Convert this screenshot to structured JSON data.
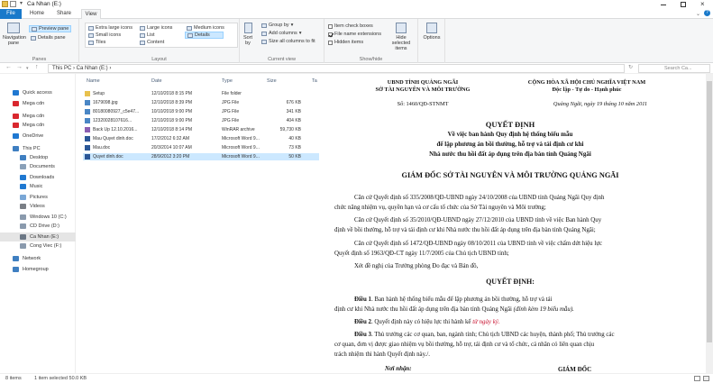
{
  "window": {
    "title": "Ca Nhan (E:)"
  },
  "tabs": [
    "File",
    "Home",
    "Share",
    "View"
  ],
  "ribbon": {
    "panes": {
      "navigation": "Navigation pane",
      "preview": "Preview pane",
      "details": "Details pane",
      "label": "Panes"
    },
    "layout": {
      "items": [
        "Extra large icons",
        "Large icons",
        "Medium icons",
        "Small icons",
        "List",
        "Details",
        "Tiles",
        "Content"
      ],
      "label": "Layout"
    },
    "current_view": {
      "sort": "Sort by",
      "group": "Group by",
      "add_columns": "Add columns",
      "size_all": "Size all columns to fit",
      "label": "Current view"
    },
    "show_hide": {
      "item_check": "Item check boxes",
      "extensions": "File name extensions",
      "hidden": "Hidden items",
      "hide_selected": "Hide selected items",
      "label": "Show/hide"
    },
    "options": "Options"
  },
  "address": {
    "path": "This PC  ›  Ca Nhan (E:)  ›",
    "search_placeholder": "Search Ca..."
  },
  "nav": [
    {
      "label": "Quick access",
      "color": "#1f78d1"
    },
    {
      "label": "Mega cdn",
      "color": "#d9272e"
    },
    {
      "label": "Mega cdn",
      "color": "#d9272e"
    },
    {
      "label": "Mega cdn",
      "color": "#d9272e"
    },
    {
      "label": "OneDrive",
      "color": "#1f78d1"
    },
    {
      "label": "This PC",
      "color": "#3f7fc1"
    },
    {
      "label": "Desktop",
      "color": "#3f7fc1"
    },
    {
      "label": "Documents",
      "color": "#8aa0b8"
    },
    {
      "label": "Downloads",
      "color": "#1f78d1"
    },
    {
      "label": "Music",
      "color": "#1f78d1"
    },
    {
      "label": "Pictures",
      "color": "#7aa7d6"
    },
    {
      "label": "Videos",
      "color": "#7a7f86"
    },
    {
      "label": "Windows 10 (C:)",
      "color": "#8a9aad"
    },
    {
      "label": "CD Drive (D:)",
      "color": "#8a9aad"
    },
    {
      "label": "Ca Nhan (E:)",
      "color": "#6b7785"
    },
    {
      "label": "Cong Viec (F:)",
      "color": "#8a9aad"
    },
    {
      "label": "Network",
      "color": "#3f7fc1"
    },
    {
      "label": "Homegroup",
      "color": "#3f7fc1"
    }
  ],
  "columns": [
    "Name",
    "Date",
    "Type",
    "Size",
    "Ta"
  ],
  "files": [
    {
      "name": "Setup",
      "date": "12/10/2018 8:15 PM",
      "type": "File folder",
      "size": "",
      "color": "#e8c14d"
    },
    {
      "name": "1679098.jpg",
      "date": "12/10/2018 8:39 PM",
      "type": "JPG File",
      "size": "676 KB",
      "color": "#4a86c5"
    },
    {
      "name": "80180080927_c5e47...",
      "date": "10/10/2018 9:00 PM",
      "type": "JPG File",
      "size": "341 KB",
      "color": "#4a86c5"
    },
    {
      "name": "12320028107616...",
      "date": "12/10/2018 9:00 PM",
      "type": "JPG File",
      "size": "404 KB",
      "color": "#4a86c5"
    },
    {
      "name": "Back Up 12.10.2016...",
      "date": "12/10/2018 8:14 PM",
      "type": "WinRAR archive",
      "size": "59,730 KB",
      "color": "#8b5fb3"
    },
    {
      "name": "Mau Quyet dinh.doc",
      "date": "17/2/2012 6:32 AM",
      "type": "Microsoft Word 9...",
      "size": "40 KB",
      "color": "#2b5797"
    },
    {
      "name": "Mau.doc",
      "date": "20/3/2014 10:07 AM",
      "type": "Microsoft Word 9...",
      "size": "73 KB",
      "color": "#2b5797"
    },
    {
      "name": "Quyet dinh.doc",
      "date": "28/9/2012 3:20 PM",
      "type": "Microsoft Word 9...",
      "size": "50 KB",
      "color": "#2b5797"
    }
  ],
  "doc": {
    "org1": "UBND TỈNH QUẢNG NGÃI",
    "org2": "SỞ TÀI NGUYÊN VÀ MÔI TRƯỜNG",
    "nation1": "CỘNG HÒA XÃ HỘI CHỦ NGHĨA VIỆT NAM",
    "nation2": "Độc lập - Tự do - Hạnh phúc",
    "number": "Số: 1460/QĐ-STNMT",
    "date": "Quảng Ngãi, ngày 19 tháng 10 năm 2011",
    "title": "QUYẾT ĐỊNH",
    "sub1": "Về việc ban hành Quy định hệ thống biểu mẫu",
    "sub2": "để lập phương án bồi thường, hỗ trợ và tái định cư khi",
    "sub3": "Nhà nước thu hồi đất áp dụng trên địa bàn tỉnh Quảng Ngãi",
    "director": "GIÁM ĐỐC SỞ TÀI NGUYÊN VÀ MÔI TRƯỜNG QUẢNG NGÃI",
    "p1a": "Căn cứ Quyết định số 335/2008/QĐ-UBND ngày 24/10/2008 của UBND tỉnh Quảng Ngãi Quy định",
    "p1b": "chức năng nhiệm vụ, quyền hạn và cơ cấu tổ chức của Sở Tài nguyên và Môi trường;",
    "p2a": "Căn cứ Quyết định số 35/2010/QĐ-UBND ngày 27/12/2010 của UBND tỉnh về việc Ban hành Quy",
    "p2b": "định về bồi thường, hỗ trợ và tái định cư khi Nhà nước thu hồi đất áp dụng trên địa bàn tỉnh Quảng Ngãi;",
    "p3a": "Căn cứ Quyết định số 1472/QĐ-UBND ngày 08/10/2011 của UBND tỉnh về việc chấm dứt hiệu lực",
    "p3b": "Quyết định số 1963/QĐ-CT ngày 11/7/2005 của Chủ tịch UBND tỉnh;",
    "p4": "Xét đề nghị của Trưởng phòng Đo đạc và Bản đồ,",
    "decide": "QUYẾT ĐỊNH:",
    "a1_label": "Điều 1",
    "a1a": ". Ban hành hệ thống biểu mẫu để lập phương án bồi thường, hỗ trợ và tái",
    "a1b": "định cư khi Nhà nước thu hồi đất áp dụng trên địa bàn tỉnh Quảng Ngãi",
    "a1c": "(đính kèm 19 biểu mẫu).",
    "a2_label": "Điều 2",
    "a2a": ". Quyết định này có hiệu lực thi hành kể",
    "a2b": "từ ngày ký.",
    "a3_label": "Điều 3",
    "a3a": ". Thủ trưởng các cơ quan, ban, ngành tỉnh; Chủ tịch UBND các huyện, thành phố; Thủ trưởng các",
    "a3b": "cơ quan, đơn vị được giao nhiệm vụ bồi thường, hỗ trợ, tái định cư và tổ chức, cá nhân có liên quan chịu",
    "a3c": "trách nhiệm thi hành Quyết định này./.",
    "recipient": "Nơi nhận:",
    "signer": "GIÁM ĐỐC"
  },
  "status": {
    "count": "8 items",
    "selected": "1 item selected  50.0 KB"
  }
}
